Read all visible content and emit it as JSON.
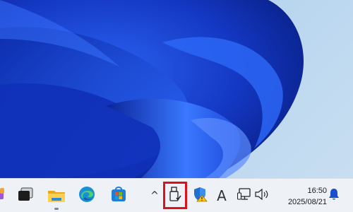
{
  "taskbar": {
    "icons": {
      "widget_partial": "widgets-icon",
      "task_view": "task-view-icon",
      "file_explorer": "folder-icon",
      "edge": "edge-browser-icon",
      "store": "microsoft-store-icon",
      "overflow": "chevron-up-icon",
      "usb": "usb-drive-icon",
      "security": "windows-security-icon",
      "ime": "ime-font-icon",
      "network": "network-icon",
      "volume": "volume-icon",
      "notifications": "bell-icon"
    },
    "overflow_glyph": "^",
    "ime_glyph": "A",
    "clock": {
      "time": "16:50",
      "date": "2025/08/21"
    }
  },
  "colors": {
    "taskbar_bg": "#eef1f6",
    "highlight": "#e0101a",
    "wallpaper_blue": "#1a45d6",
    "accent_blue": "#1a66d8"
  }
}
